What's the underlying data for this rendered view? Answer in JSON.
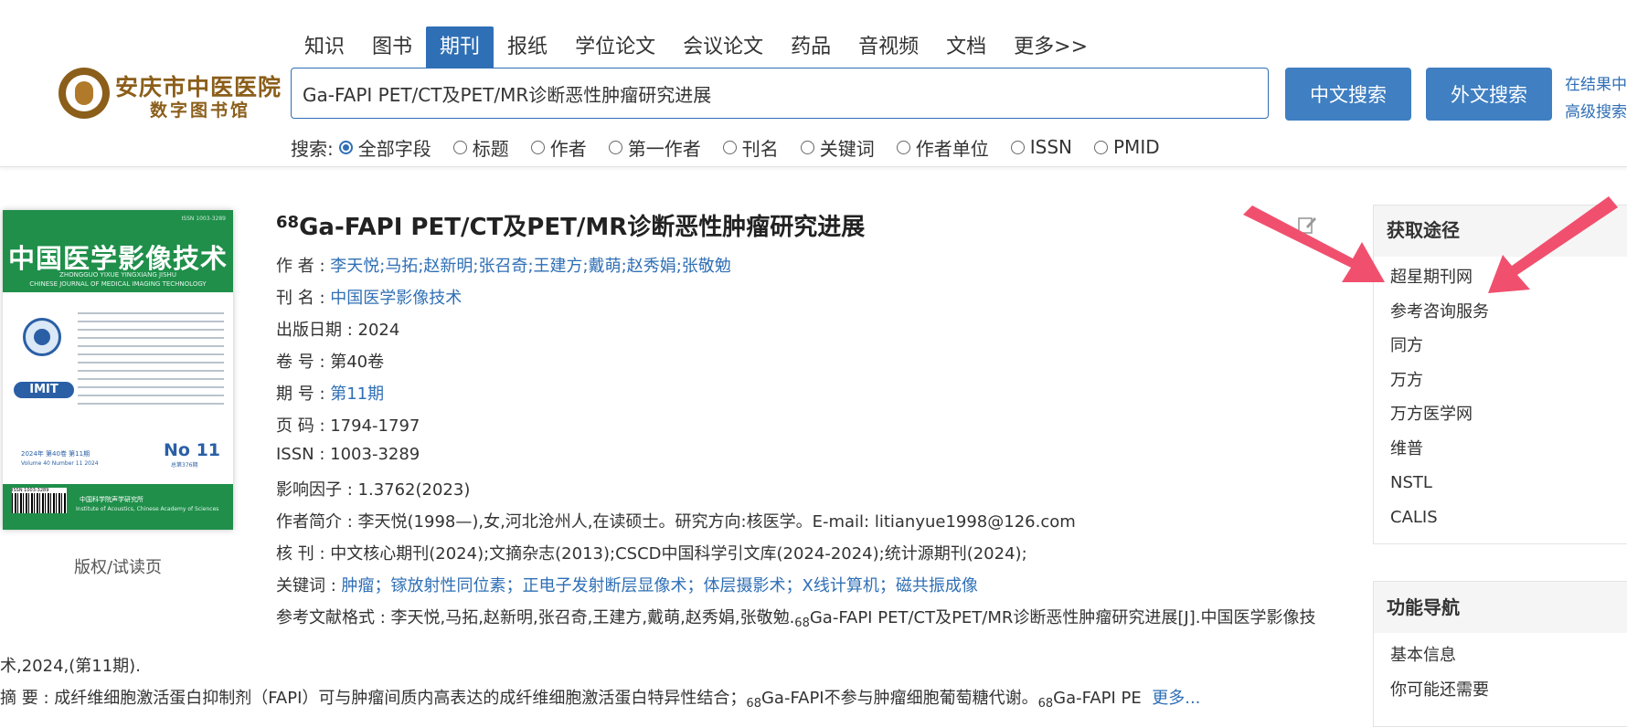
{
  "logo": {
    "line1": "安庆市中医医院",
    "line2": "数字图书馆"
  },
  "tabs": [
    {
      "label": "知识",
      "active": false
    },
    {
      "label": "图书",
      "active": false
    },
    {
      "label": "期刊",
      "active": true
    },
    {
      "label": "报纸",
      "active": false
    },
    {
      "label": "学位论文",
      "active": false
    },
    {
      "label": "会议论文",
      "active": false
    },
    {
      "label": "药品",
      "active": false
    },
    {
      "label": "音视频",
      "active": false
    },
    {
      "label": "文档",
      "active": false
    },
    {
      "label": "更多>>",
      "active": false
    }
  ],
  "search": {
    "value": "Ga-FAPI PET/CT及PET/MR诊断恶性肿瘤研究进展",
    "cn_button": "中文搜索",
    "en_button": "外文搜索",
    "side_link1": "在结果中",
    "side_link2": "高级搜索",
    "fields_label": "搜索:",
    "fields": [
      "全部字段",
      "标题",
      "作者",
      "第一作者",
      "刊名",
      "关键词",
      "作者单位",
      "ISSN",
      "PMID"
    ],
    "selected_field": "全部字段"
  },
  "cover": {
    "title": "中国医学影像技术",
    "pinyin": "ZHONGGUO YIXUE YINGXIANG JISHU",
    "english": "CHINESE JOURNAL OF MEDICAL IMAGING TECHNOLOGY",
    "issn_top": "ISSN 1003-3289",
    "logo": "IMIT",
    "date_line": "2024年 第40卷 第11期",
    "date_line2": "Volume 40 Number 11 2024",
    "number": "No 11",
    "number_sub": "总第376期",
    "publisher": "中国科学院声学研究所",
    "publisher_en": "Institute of Acoustics, Chinese Academy of Sciences",
    "barcode_text": "ISSN 1003-3289",
    "caption": "版权/试读页"
  },
  "article": {
    "title_sup": "68",
    "title": "Ga-FAPI PET/CT及PET/MR诊断恶性肿瘤研究进展",
    "authors_label": "作  者 : ",
    "authors": [
      "李天悦",
      "马拓",
      "赵新明",
      "张召奇",
      "王建方",
      "戴萌",
      "赵秀娟",
      "张敬勉"
    ],
    "journal_label": "刊  名 : ",
    "journal": "中国医学影像技术",
    "pubdate_label": "出版日期 : ",
    "pubdate": "2024",
    "volume_label": "卷  号 : ",
    "volume": "第40卷",
    "issue_label": "期  号 : ",
    "issue": "第11期",
    "pages_label": "页  码 : ",
    "pages": "1794-1797",
    "issn_label": "ISSN : ",
    "issn": "1003-3289",
    "impact_label": "影响因子 : ",
    "impact": "1.3762(2023)",
    "bio_label": "作者简介 : ",
    "bio": "李天悦(1998—),女,河北沧州人,在读硕士。研究方向:核医学。E-mail: litianyue1998@126.com",
    "core_label": "核  刊 : ",
    "core": "中文核心期刊(2024);文摘杂志(2013);CSCD中国科学引文库(2024-2024);统计源期刊(2024);",
    "keywords_label": "关键词 : ",
    "keywords": [
      "肿瘤",
      "镓放射性同位素",
      "正电子发射断层显像术",
      "体层摄影术",
      "X线计算机",
      "磁共振成像"
    ],
    "citation_label": "参考文献格式 : ",
    "citation_pre": "李天悦,马拓,赵新明,张召奇,王建方,戴萌,赵秀娟,张敬勉.",
    "citation_sub": "68",
    "citation_post": "Ga-FAPI PET/CT及PET/MR诊断恶性肿瘤研究进展[J].中国医学影像技",
    "citation_wrap": "术,2024,(第11期).",
    "abstract_label": "摘  要 : ",
    "abstract_a": "成纤维细胞激活蛋白抑制剂（FAPI）可与肿瘤间质内高表达的成纤维细胞激活蛋白特异性结合；",
    "abstract_sub1": "68",
    "abstract_b": "Ga-FAPI不参与肿瘤细胞葡萄糖代谢。",
    "abstract_sub2": "68",
    "abstract_c": "Ga-FAPI PE",
    "more": "更多..."
  },
  "panel_access": {
    "title": "获取途径",
    "items": [
      "超星期刊网",
      "参考咨询服务",
      "同方",
      "万方",
      "万方医学网",
      "维普",
      "NSTL",
      "CALIS"
    ]
  },
  "panel_nav": {
    "title": "功能导航",
    "items": [
      "基本信息",
      "你可能还需要"
    ]
  },
  "colors": {
    "accent": "#2f6fb5",
    "button": "#3f7fc2",
    "arrow": "#f0506e",
    "cover_green": "#1f8f4a",
    "logo_brown": "#8b5e1a"
  }
}
